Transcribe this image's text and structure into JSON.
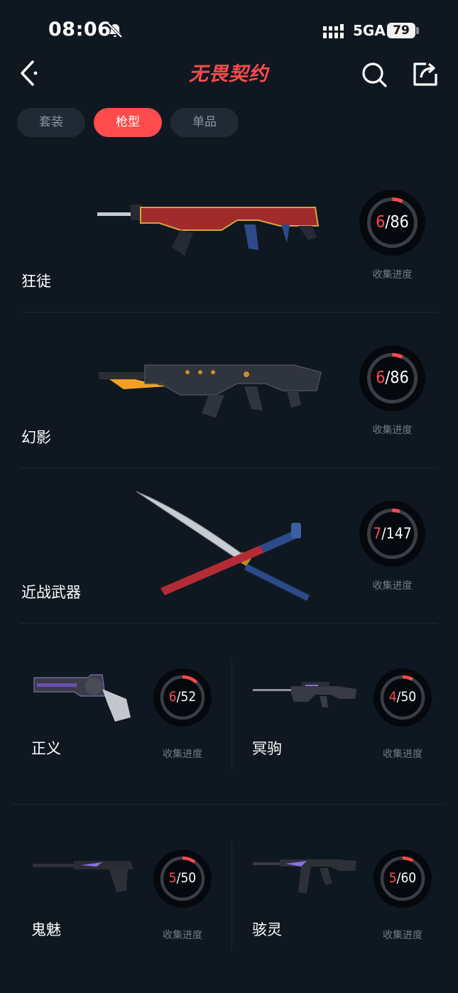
{
  "status": {
    "time": "08:06",
    "network": "5GA",
    "battery": "79"
  },
  "header": {
    "logo_text": "无畏契约",
    "colors": {
      "accent": "#ff4b4b",
      "background": "#0f1821"
    }
  },
  "tabs": [
    {
      "label": "套装",
      "active": false
    },
    {
      "label": "枪型",
      "active": true
    },
    {
      "label": "单品",
      "active": false
    }
  ],
  "progress_caption": "收集进度",
  "categories": [
    {
      "name": "狂徒",
      "current": "6",
      "total": "86",
      "fraction": 0.07,
      "image": "vandal-rifle"
    },
    {
      "name": "幻影",
      "current": "6",
      "total": "86",
      "fraction": 0.07,
      "image": "phantom-rifle"
    },
    {
      "name": "近战武器",
      "current": "7",
      "total": "147",
      "fraction": 0.05,
      "image": "katana-melee"
    },
    {
      "name": "正义",
      "current": "6",
      "total": "52",
      "fraction": 0.12,
      "image": "sheriff-pistol"
    },
    {
      "name": "冥驹",
      "current": "4",
      "total": "50",
      "fraction": 0.08,
      "image": "marshal-sniper"
    },
    {
      "name": "鬼魅",
      "current": "5",
      "total": "50",
      "fraction": 0.1,
      "image": "ghost-pistol"
    },
    {
      "name": "骇灵",
      "current": "5",
      "total": "60",
      "fraction": 0.08,
      "image": "spectre-smg"
    }
  ]
}
